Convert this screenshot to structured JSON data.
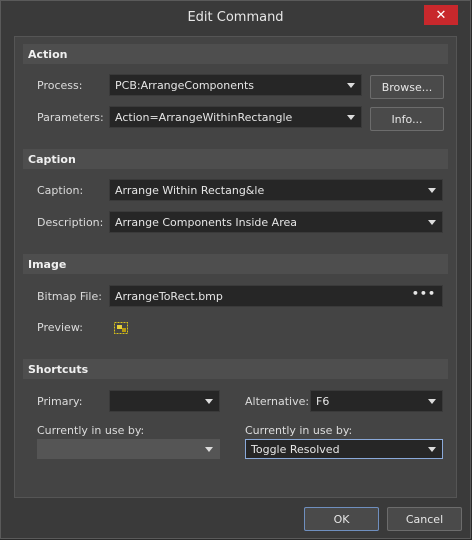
{
  "window": {
    "title": "Edit Command",
    "close_glyph": "✕"
  },
  "sections": {
    "action": "Action",
    "caption": "Caption",
    "image": "Image",
    "shortcuts": "Shortcuts"
  },
  "action": {
    "process_label": "Process:",
    "process_value": "PCB:ArrangeComponents",
    "parameters_label": "Parameters:",
    "parameters_value": "Action=ArrangeWithinRectangle",
    "browse_label": "Browse...",
    "info_label": "Info..."
  },
  "caption": {
    "caption_label": "Caption:",
    "caption_value": "Arrange Within Rectang&le",
    "description_label": "Description:",
    "description_value": "Arrange Components Inside Area"
  },
  "image": {
    "bitmap_label": "Bitmap File:",
    "bitmap_value": "ArrangeToRect.bmp",
    "bitmap_more": "•••",
    "preview_label": "Preview:"
  },
  "shortcuts": {
    "primary_label": "Primary:",
    "primary_value": "",
    "alternative_label": "Alternative:",
    "alternative_value": "F6",
    "in_use_label_left": "Currently in use by:",
    "in_use_value_left": "",
    "in_use_label_right": "Currently in use by:",
    "in_use_value_right": "Toggle Resolved"
  },
  "footer": {
    "ok_label": "OK",
    "cancel_label": "Cancel"
  },
  "colors": {
    "close": "#c8282c",
    "background_strip": "#d8c20a"
  }
}
